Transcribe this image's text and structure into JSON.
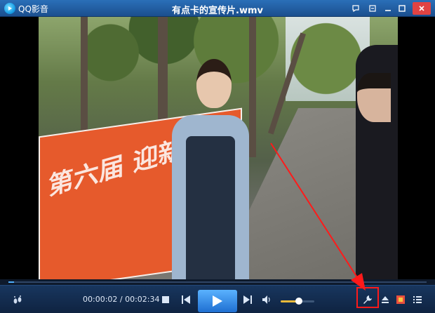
{
  "app": {
    "name": "QQ影音",
    "window_title": "有点卡的宣传片.wmv"
  },
  "titlebar_buttons": [
    "chat-icon",
    "pin-icon",
    "minimize-icon",
    "maximize-icon",
    "close-icon"
  ],
  "video": {
    "file": "有点卡的宣传片.wmv",
    "banner_text": "第六届 迎新晚会"
  },
  "playback": {
    "current_time": "00:00:02",
    "total_time": "00:02:34",
    "time_display": "00:00:02 / 00:02:34",
    "progress_fraction": 0.013,
    "volume_fraction": 0.55
  },
  "controls": {
    "left": [
      "footprint-icon"
    ],
    "transport": [
      "stop-icon",
      "prev-icon",
      "play-icon",
      "next-icon",
      "volume-icon"
    ],
    "right": [
      "wrench-icon",
      "eject-icon",
      "screenshot-icon",
      "playlist-icon"
    ]
  },
  "colors": {
    "titlebar": "#2a6fb8",
    "controlbar": "#18365e",
    "accent": "#4fb0ff",
    "volume": "#e8b93a",
    "annotation": "#ff1a1a"
  }
}
